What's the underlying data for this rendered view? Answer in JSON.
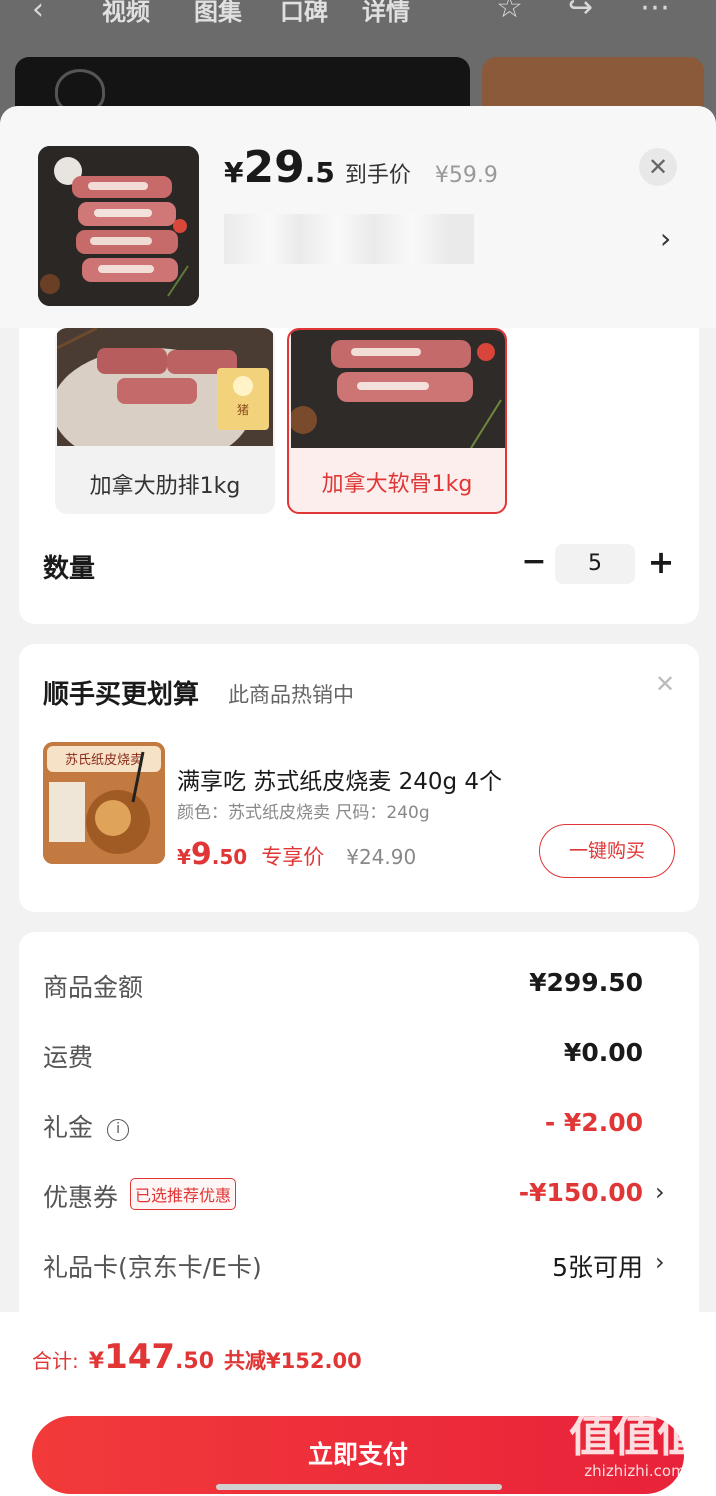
{
  "background_page": {
    "tabs": [
      "视频",
      "图集",
      "口碑",
      "详情"
    ]
  },
  "header": {
    "price_int": "29",
    "price_dec": ".5",
    "currency": "¥",
    "price_label": "到手价",
    "original_price": "¥59.9",
    "close_label": "✕",
    "chevron": "›"
  },
  "spec": {
    "options": [
      {
        "label": "加拿大肋排1kg",
        "selected": false
      },
      {
        "label": "加拿大软骨1kg",
        "selected": true
      }
    ],
    "quantity_label": "数量",
    "quantity_value": "5",
    "minus": "−",
    "plus": "+"
  },
  "upsell": {
    "title": "顺手买更划算",
    "subtitle": "此商品热销中",
    "close": "✕",
    "image_text": "苏氏纸皮烧卖",
    "product_name": "满享吃 苏式纸皮烧麦 240g 4个",
    "attributes": "颜色：苏式纸皮烧卖   尺码：240g",
    "currency": "¥",
    "price_int": "9",
    "price_dec": ".50",
    "price_tag": "专享价",
    "original_price": "¥24.90",
    "buy_button": "一键购买"
  },
  "summary": {
    "rows": [
      {
        "label": "商品金额",
        "value": "¥299.50"
      },
      {
        "label": "运费",
        "value": "¥0.00"
      },
      {
        "label": "礼金",
        "value": "- ¥2.00"
      },
      {
        "label": "优惠券",
        "badge": "已选推荐优惠",
        "value": "-¥150.00"
      },
      {
        "label": "礼品卡(京东卡/E卡)",
        "value": "5张可用"
      }
    ],
    "info_icon": "i",
    "chevron": "›"
  },
  "footer": {
    "total_label": "合计:",
    "currency": "¥",
    "total_int": "147",
    "total_dec": ".50",
    "saved": "共减¥152.00",
    "pay_button": "立即支付"
  },
  "watermark": {
    "glyph": "值值值",
    "url": "zhizhizhi.com"
  },
  "colors": {
    "accent": "#e03636",
    "pay_gradient_start": "#f23a3a",
    "pay_gradient_end": "#e8223a"
  }
}
